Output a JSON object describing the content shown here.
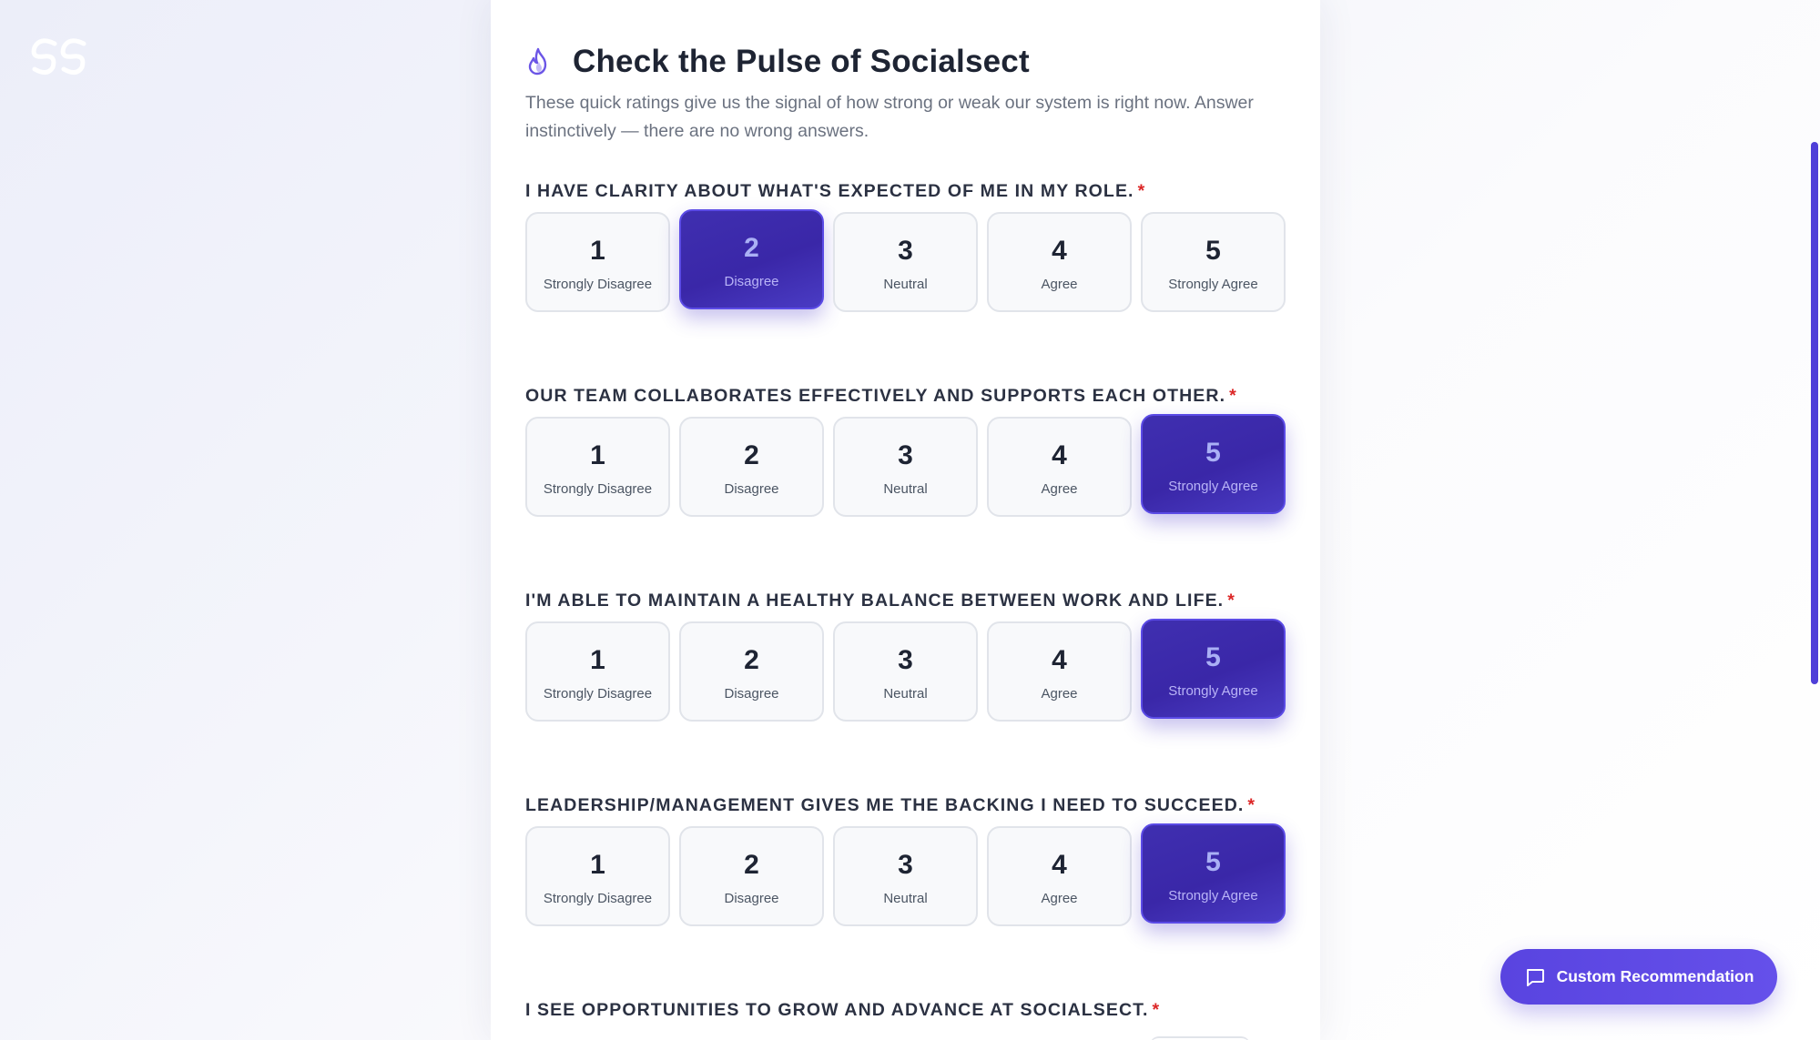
{
  "header": {
    "title": "Check the Pulse of Socialsect",
    "subtitle": "These quick ratings give us the signal of how strong or weak our system is right now. Answer instinctively — there are no wrong answers."
  },
  "scale": [
    {
      "value": "1",
      "label": "Strongly Disagree"
    },
    {
      "value": "2",
      "label": "Disagree"
    },
    {
      "value": "3",
      "label": "Neutral"
    },
    {
      "value": "4",
      "label": "Agree"
    },
    {
      "value": "5",
      "label": "Strongly Agree"
    }
  ],
  "questions": [
    {
      "text": "I have clarity about what's expected of me in my role.",
      "required_mark": "*",
      "selected": 2
    },
    {
      "text": "Our team collaborates effectively and supports each other.",
      "required_mark": "*",
      "selected": 5
    },
    {
      "text": "I'm able to maintain a healthy balance between work and life.",
      "required_mark": "*",
      "selected": 5
    },
    {
      "text": "Leadership/management gives me the backing I need to succeed.",
      "required_mark": "*",
      "selected": 5
    },
    {
      "text": "I see opportunities to grow and advance at Socialsect.",
      "required_mark": "*",
      "selected": null
    }
  ],
  "fab": {
    "label": "Custom Recommendation",
    "icon": "chat-bubble-icon"
  },
  "colors": {
    "accent": "#3f2fb0",
    "accent_border": "#5b4be6",
    "required": "#dc2626",
    "fab": "#5944e0"
  },
  "icons": {
    "logo": "socialsect-logo",
    "title_icon": "flame-icon"
  }
}
